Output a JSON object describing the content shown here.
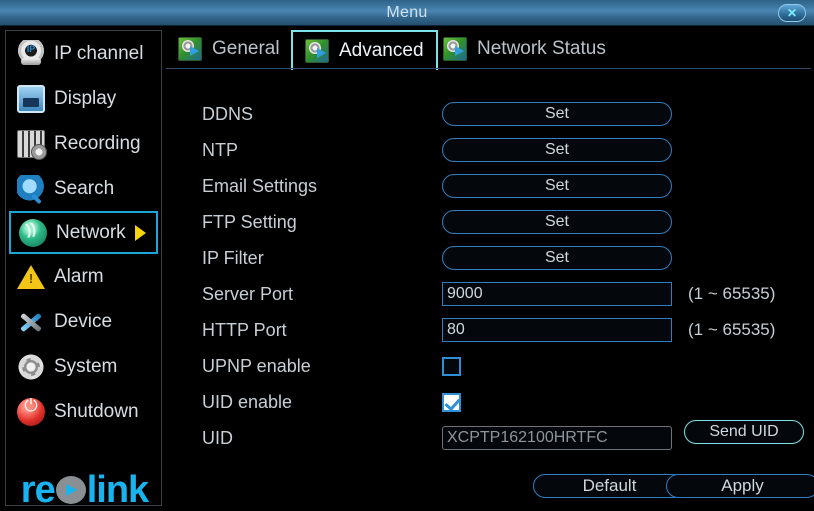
{
  "titlebar": {
    "title": "Menu",
    "close_label": "✕"
  },
  "sidebar": {
    "items": [
      {
        "label": "IP channel",
        "icon": "ip-camera-icon",
        "selected": false
      },
      {
        "label": "Display",
        "icon": "display-icon",
        "selected": false
      },
      {
        "label": "Recording",
        "icon": "recording-icon",
        "selected": false
      },
      {
        "label": "Search",
        "icon": "search-icon",
        "selected": false
      },
      {
        "label": "Network",
        "icon": "network-icon",
        "selected": true
      },
      {
        "label": "Alarm",
        "icon": "alarm-icon",
        "selected": false
      },
      {
        "label": "Device",
        "icon": "device-tools-icon",
        "selected": false
      },
      {
        "label": "System",
        "icon": "gear-icon",
        "selected": false
      },
      {
        "label": "Shutdown",
        "icon": "power-icon",
        "selected": false
      }
    ],
    "logo": {
      "part1": "re",
      "part2": "link"
    }
  },
  "tabs": [
    {
      "label": "General",
      "icon": "settings-arrow-icon",
      "active": false
    },
    {
      "label": "Advanced",
      "icon": "settings-arrow-icon",
      "active": true
    },
    {
      "label": "Network Status",
      "icon": "settings-arrow-icon",
      "active": false
    }
  ],
  "form": {
    "ddns": {
      "label": "DDNS",
      "button": "Set"
    },
    "ntp": {
      "label": "NTP",
      "button": "Set"
    },
    "email": {
      "label": "Email Settings",
      "button": "Set"
    },
    "ftp": {
      "label": "FTP Setting",
      "button": "Set"
    },
    "ipfilter": {
      "label": "IP Filter",
      "button": "Set"
    },
    "server_port": {
      "label": "Server Port",
      "value": "9000",
      "hint": "(1 ~ 65535)"
    },
    "http_port": {
      "label": "HTTP Port",
      "value": "80",
      "hint": "(1 ~ 65535)"
    },
    "upnp": {
      "label": "UPNP enable",
      "checked": false
    },
    "uid_enable": {
      "label": "UID enable",
      "checked": true
    },
    "uid": {
      "label": "UID",
      "value": "XCPTP162100HRTFC",
      "send_label": "Send UID"
    }
  },
  "footer": {
    "default_label": "Default",
    "apply_label": "Apply"
  },
  "colors": {
    "accent_blue": "#2f7fc4",
    "highlight_cyan": "#7ee3e8",
    "select_cyan": "#1aa6d6",
    "arrow_yellow": "#f5d40a",
    "logo_blue": "#18b4f0"
  }
}
